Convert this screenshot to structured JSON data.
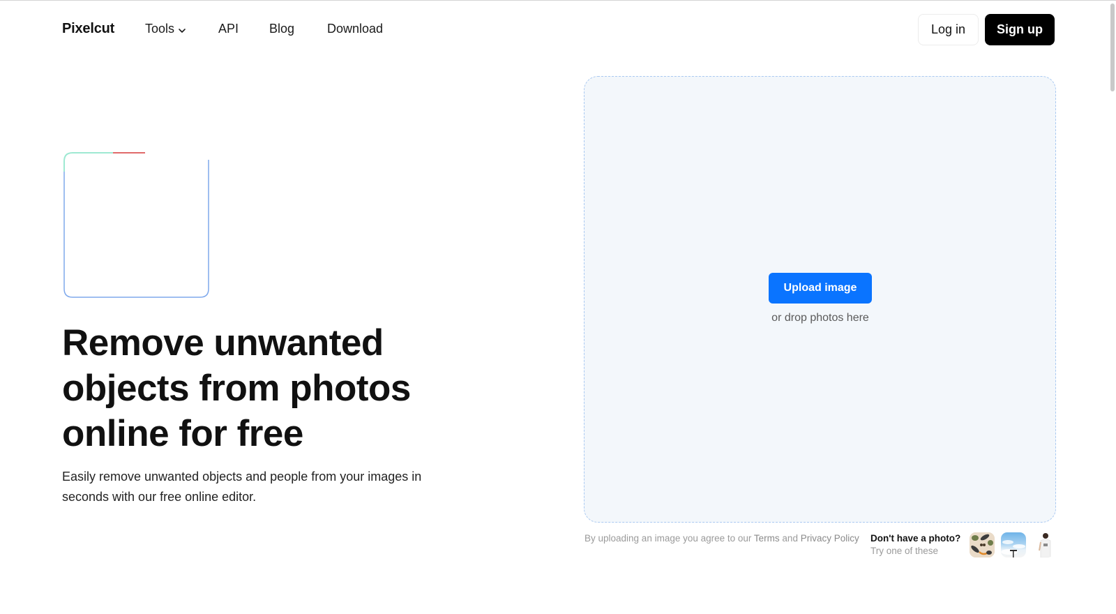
{
  "nav": {
    "logo": "Pixelcut",
    "links": [
      {
        "label": "Tools",
        "has_dropdown": true
      },
      {
        "label": "API"
      },
      {
        "label": "Blog"
      },
      {
        "label": "Download"
      }
    ],
    "login_label": "Log in",
    "signup_label": "Sign up"
  },
  "hero": {
    "headline": "Remove unwanted objects from photos online for free",
    "subtext": "Easily remove unwanted objects and people from your images in seconds with our free online editor."
  },
  "upload": {
    "button_label": "Upload image",
    "drop_hint": "or drop photos here",
    "terms_prefix": "By uploading an image you agree to our ",
    "terms_link": "Terms",
    "terms_and": " and ",
    "privacy_link": "Privacy Policy"
  },
  "samples": {
    "title": "Don't have a photo?",
    "subtitle": "Try one of these",
    "items": [
      {
        "name": "fashion-accessories-flatlay"
      },
      {
        "name": "sky-with-streetlamp"
      },
      {
        "name": "person-in-white-shirt"
      }
    ]
  },
  "colors": {
    "primary": "#0a74ff",
    "signup_bg": "#000000",
    "dropzone_bg": "#f3f7fb",
    "dropzone_border": "#a9c9f1"
  }
}
